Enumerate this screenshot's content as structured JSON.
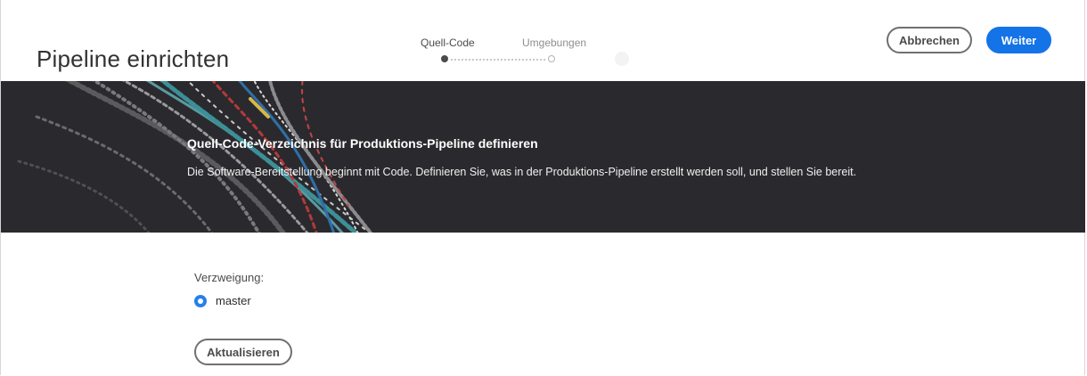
{
  "header": {
    "title": "Pipeline einrichten",
    "steps": [
      {
        "label": "Quell-Code",
        "state": "active"
      },
      {
        "label": "Umgebungen",
        "state": "inactive"
      }
    ],
    "cancel_label": "Abbrechen",
    "next_label": "Weiter"
  },
  "banner": {
    "title": "Quell-Code-Verzeichnis für Produktions-Pipeline definieren",
    "description": "Die Software-Bereitstellung beginnt mit Code. Definieren Sie, was in der Produktions-Pipeline erstellt werden soll, und stellen Sie bereit."
  },
  "form": {
    "branch_label": "Verzweigung:",
    "branches": [
      {
        "label": "master",
        "selected": true
      }
    ],
    "refresh_label": "Aktualisieren"
  },
  "colors": {
    "accent": "#1473e6",
    "banner_bg": "#2a2a2e",
    "radio_selected": "#2680eb"
  }
}
